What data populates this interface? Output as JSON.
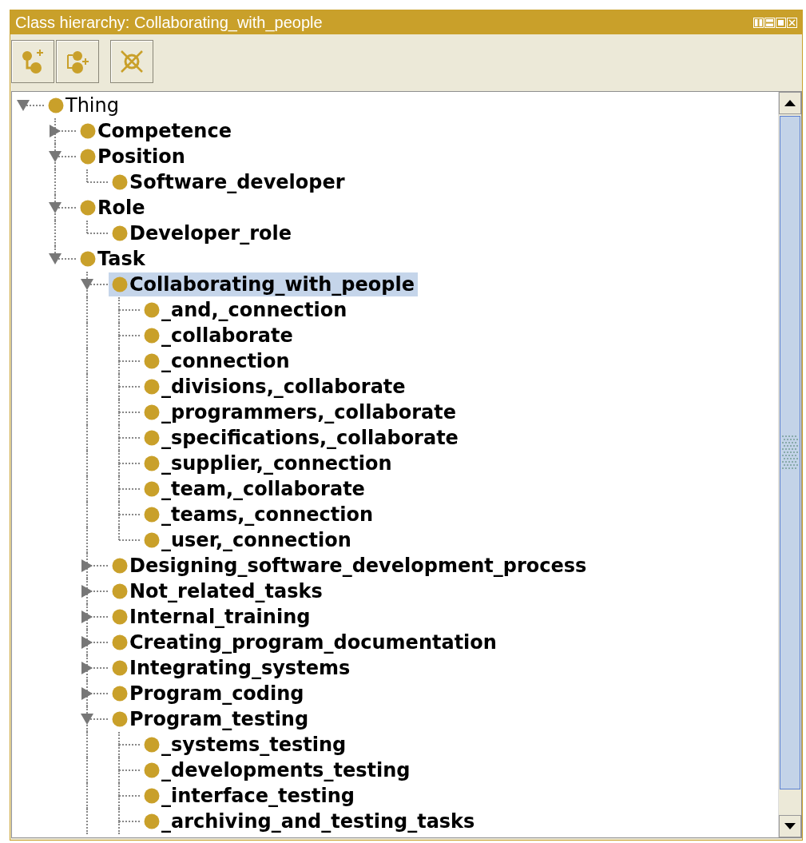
{
  "window": {
    "title": "Class hierarchy: Collaborating_with_people"
  },
  "toolbar": {
    "buttons": [
      {
        "kind": "add-subclass"
      },
      {
        "kind": "add-sibling"
      },
      {
        "kind": "delete"
      }
    ]
  },
  "tree": {
    "nodes": [
      {
        "label": "Thing",
        "bold": false,
        "selected": false,
        "expanded": true,
        "children": [
          {
            "label": "Competence",
            "bold": true,
            "selected": false,
            "expanded": false
          },
          {
            "label": "Position",
            "bold": true,
            "selected": false,
            "expanded": true,
            "children": [
              {
                "label": "Software_developer",
                "bold": true,
                "selected": false
              }
            ]
          },
          {
            "label": "Role",
            "bold": true,
            "selected": false,
            "expanded": true,
            "children": [
              {
                "label": "Developer_role",
                "bold": true,
                "selected": false
              }
            ]
          },
          {
            "label": "Task",
            "bold": true,
            "selected": false,
            "expanded": true,
            "truncated": true,
            "children": [
              {
                "label": "Collaborating_with_people",
                "bold": true,
                "selected": true,
                "expanded": true,
                "children": [
                  {
                    "label": "_and,_connection",
                    "bold": true,
                    "selected": false
                  },
                  {
                    "label": "_collaborate",
                    "bold": true,
                    "selected": false
                  },
                  {
                    "label": "_connection",
                    "bold": true,
                    "selected": false
                  },
                  {
                    "label": "_divisions,_collaborate",
                    "bold": true,
                    "selected": false
                  },
                  {
                    "label": "_programmers,_collaborate",
                    "bold": true,
                    "selected": false
                  },
                  {
                    "label": "_specifications,_collaborate",
                    "bold": true,
                    "selected": false
                  },
                  {
                    "label": "_supplier,_connection",
                    "bold": true,
                    "selected": false
                  },
                  {
                    "label": "_team,_collaborate",
                    "bold": true,
                    "selected": false
                  },
                  {
                    "label": "_teams,_connection",
                    "bold": true,
                    "selected": false
                  },
                  {
                    "label": "_user,_connection",
                    "bold": true,
                    "selected": false
                  }
                ]
              },
              {
                "label": "Designing_software_development_process",
                "bold": true,
                "selected": false,
                "expanded": false
              },
              {
                "label": "Not_related_tasks",
                "bold": true,
                "selected": false,
                "expanded": false
              },
              {
                "label": "Internal_training",
                "bold": true,
                "selected": false,
                "expanded": false
              },
              {
                "label": "Creating_program_documentation",
                "bold": true,
                "selected": false,
                "expanded": false
              },
              {
                "label": "Integrating_systems",
                "bold": true,
                "selected": false,
                "expanded": false
              },
              {
                "label": "Program_coding",
                "bold": true,
                "selected": false,
                "expanded": false
              },
              {
                "label": "Program_testing",
                "bold": true,
                "selected": false,
                "expanded": true,
                "truncated": true,
                "children": [
                  {
                    "label": "_systems_testing",
                    "bold": true,
                    "selected": false
                  },
                  {
                    "label": "_developments_testing",
                    "bold": true,
                    "selected": false
                  },
                  {
                    "label": "_interface_testing",
                    "bold": true,
                    "selected": false
                  },
                  {
                    "label": "_archiving_and_testing_tasks",
                    "bold": true,
                    "selected": false
                  }
                ]
              }
            ]
          }
        ]
      }
    ]
  }
}
